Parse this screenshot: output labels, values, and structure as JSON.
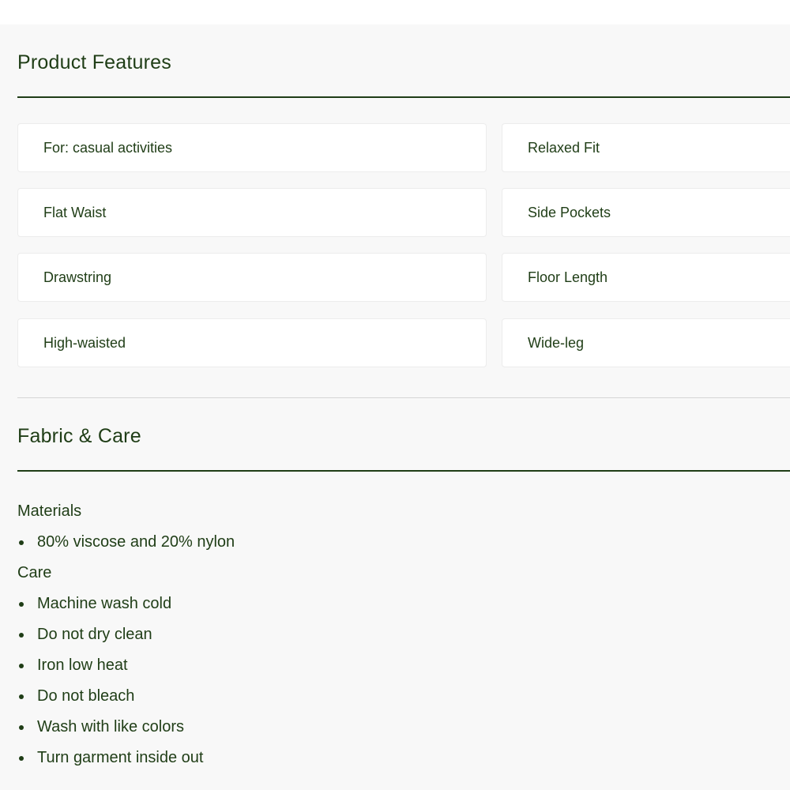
{
  "product_features": {
    "title": "Product Features",
    "items": [
      "For: casual activities",
      "Relaxed Fit",
      "Flat Waist",
      "Side Pockets",
      "Drawstring",
      "Floor Length",
      "High-waisted",
      "Wide-leg"
    ]
  },
  "fabric_care": {
    "title": "Fabric & Care",
    "materials_heading": "Materials",
    "materials": [
      "80% viscose and 20% nylon"
    ],
    "care_heading": "Care",
    "care": [
      "Machine wash cold",
      "Do not dry clean",
      "Iron low heat",
      "Do not bleach",
      "Wash with like colors",
      "Turn garment inside out"
    ]
  },
  "colors": {
    "text": "#1f3d16",
    "panel_background": "#f8f8f8",
    "card_background": "#ffffff"
  }
}
